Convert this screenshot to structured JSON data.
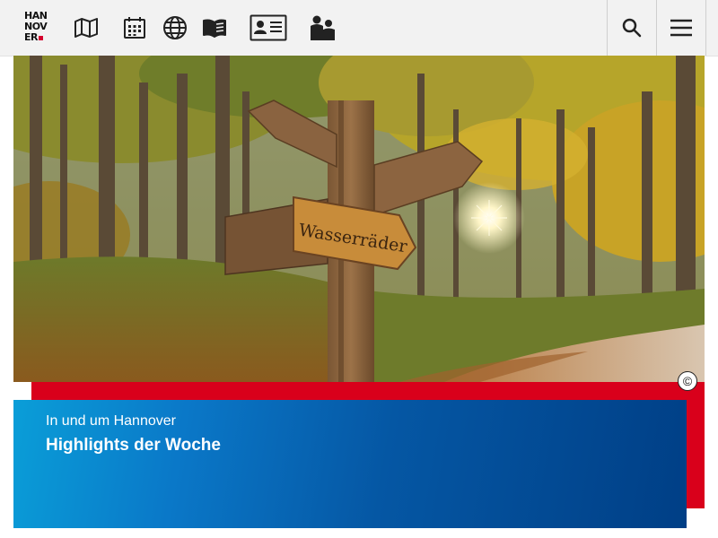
{
  "header": {
    "logo": {
      "lines": [
        "HAN",
        "NOV",
        "ER"
      ],
      "accent_color": "#d4002d"
    },
    "nav_icons": [
      "map-icon",
      "calendar-icon",
      "globe-icon",
      "book-icon",
      "id-card-icon",
      "people-icon"
    ],
    "actions": [
      "search-icon",
      "menu-icon"
    ]
  },
  "hero": {
    "sign_text": "Wasserräder",
    "copyright_symbol": "©"
  },
  "teaser": {
    "kicker": "In und um Hannover",
    "title": "Highlights der Woche",
    "colors": {
      "red": "#d9001b",
      "blue_start": "#0a9ed8",
      "blue_end": "#003f86"
    }
  }
}
